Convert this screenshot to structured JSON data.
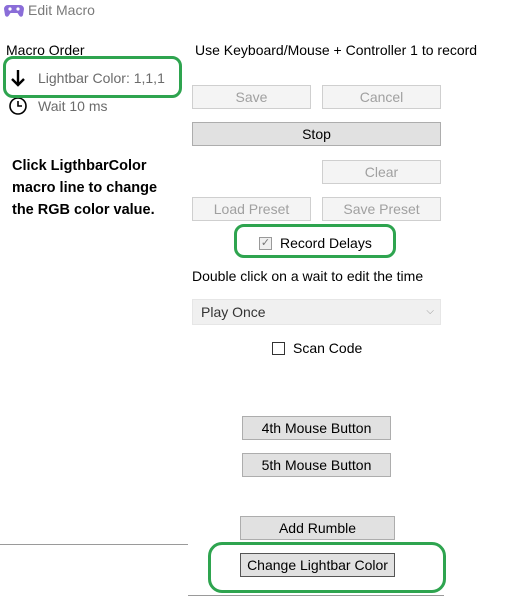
{
  "window": {
    "title": "Edit Macro",
    "icon": "gamepad-icon"
  },
  "left_panel": {
    "heading": "Macro Order",
    "items": [
      {
        "icon": "arrow-down-icon",
        "label": "Lightbar Color: 1,1,1"
      },
      {
        "icon": "clock-icon",
        "label": "Wait 10 ms"
      }
    ],
    "help_text": "Click LigthbarColor macro line to change the RGB color value."
  },
  "right_panel": {
    "instruction": "Use Keyboard/Mouse + Controller 1 to record",
    "buttons": {
      "save": "Save",
      "cancel": "Cancel",
      "stop": "Stop",
      "clear": "Clear",
      "load_preset": "Load Preset",
      "save_preset": "Save Preset",
      "fourth_mouse": "4th Mouse Button",
      "fifth_mouse": "5th Mouse Button",
      "add_rumble": "Add Rumble",
      "change_lightbar": "Change Lightbar Color"
    },
    "record_delays": {
      "label": "Record Delays",
      "checked": true
    },
    "wait_hint": "Double click on a wait to edit the time",
    "play_mode": {
      "selected": "Play Once"
    },
    "scan_code": {
      "label": "Scan Code",
      "checked": false
    }
  },
  "colors": {
    "highlight": "#2ea44f",
    "button_bg": "#e1e1e1",
    "disabled_text": "#a0a0a0"
  }
}
